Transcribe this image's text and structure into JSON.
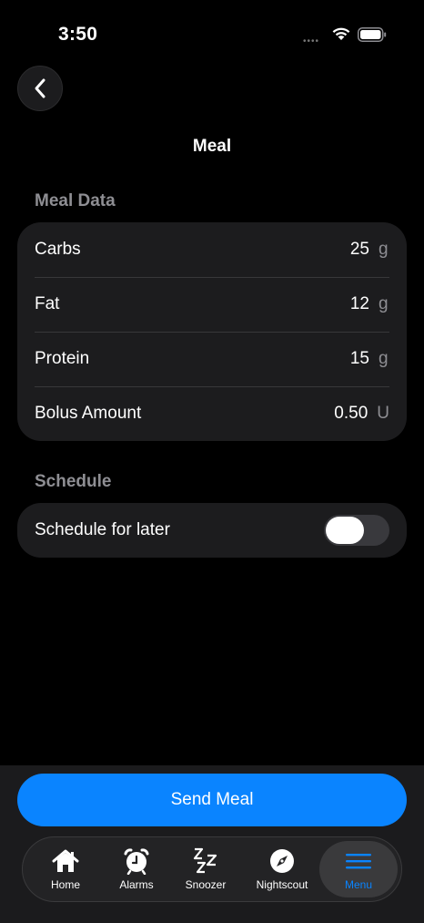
{
  "status_bar": {
    "time": "3:50",
    "signal_dots": "••••"
  },
  "nav": {
    "title": "Meal",
    "back_icon": "chevron-left-icon"
  },
  "meal_data": {
    "header": "Meal Data",
    "rows": [
      {
        "label": "Carbs",
        "value": "25",
        "unit": "g"
      },
      {
        "label": "Fat",
        "value": "12",
        "unit": "g"
      },
      {
        "label": "Protein",
        "value": "15",
        "unit": "g"
      },
      {
        "label": "Bolus Amount",
        "value": "0.50",
        "unit": "U"
      }
    ]
  },
  "schedule": {
    "header": "Schedule",
    "label": "Schedule for later",
    "enabled": false
  },
  "send_button": {
    "label": "Send Meal",
    "color": "#0a84ff"
  },
  "tabs": [
    {
      "label": "Home",
      "icon": "house-icon"
    },
    {
      "label": "Alarms",
      "icon": "alarm-clock-icon"
    },
    {
      "label": "Snoozer",
      "icon": "zzz-icon"
    },
    {
      "label": "Nightscout",
      "icon": "compass-icon"
    },
    {
      "label": "Menu",
      "icon": "menu-icon",
      "active": true
    }
  ],
  "accent_color": "#0a84ff"
}
